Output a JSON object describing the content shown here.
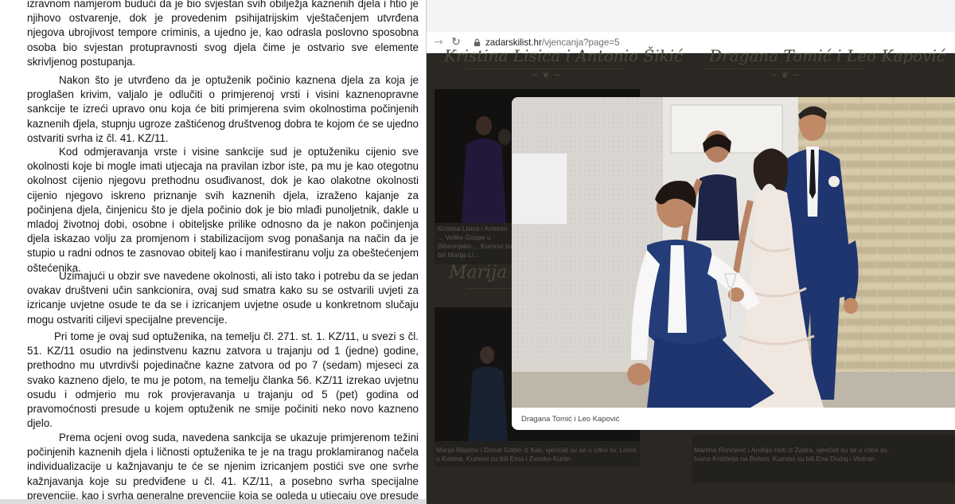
{
  "document": {
    "paragraphs": [
      "izravnom namjerom budući da je bio svjestan svih obilježja kaznenih djela i htio je njihovo ostvarenje, dok je provedenim psihijatrijskim vještačenjem utvrđena njegova ubrojivost tempore criminis, a ujedno je, kao odrasla poslovno sposobna osoba bio svjestan protupravnosti svog djela čime je ostvario sve elemente skrivljenog postupanja.",
      "Nakon što je utvrđeno da je optuženik počinio kaznena djela za koja je proglašen krivim, valjalo je odlučiti o primjerenoj vrsti i visini kaznenopravne sankcije te izreći upravo onu koja će biti primjerena svim okolnostima počinjenih kaznenih djela, stupnju ugroze zaštićenog društvenog dobra te kojom će se ujedno ostvariti svrha iz čl. 41. KZ/11.",
      "Kod odmjeravanja vrste i visine sankcije sud je optuženiku cijenio sve okolnosti koje bi mogle imati utjecaja na pravilan izbor iste, pa mu je kao otegotnu okolnost cijenio njegovu prethodnu osuđivanost, dok je kao olakotne okolnosti cijenio njegovo iskreno priznanje svih kaznenih djela, izraženo kajanje za počinjena djela, činjenicu što je djela počinio dok je bio mlađi punoljetnik, dakle u mladoj životnoj dobi, osobne i obiteljske prilike odnosno da je nakon počinjenja djela iskazao volju za promjenom i stabilizacijom svog ponašanja na način da je stupio u radni odnos te zasnovao obitelj kao i manifestiranu volju za obeštećenjem oštećenika.",
      "Uzimajući u obzir sve navedene okolnosti, ali isto tako i potrebu da se jedan ovakav društveni učin sankcionira, ovaj sud smatra kako su se ostvarili uvjeti za izricanje uvjetne osude te da se i izricanjem uvjetne osude u konkretnom slučaju mogu ostvariti ciljevi specijalne prevencije.",
      "Pri tome je ovaj sud optuženika, na temelju čl. 271. st. 1. KZ/11, u svezi s čl. 51. KZ/11 osudio  na jedinstvenu kaznu zatvora u trajanju od 1 (jedne) godine, prethodno mu utvrdivši pojedinačne kazne zatvora od po 7 (sedam) mjeseci za svako kazneno djelo, te mu je potom, na temelju članka 56. KZ/11 izrekao uvjetnu osudu i odmjerio mu rok provjeravanja u trajanju od 5 (pet) godina od pravomoćnosti presude u kojem optuženik ne smije počiniti neko novo kazneno djelo.",
      "Prema ocjeni ovog suda, navedena sankcija se ukazuje primjerenom težini počinjenih kaznenih djela i ličnosti optuženika te je na tragu proklamiranog načela individualizacije u kažnjavanju te će se njenim izricanjem postići sve one svrhe kažnjavanja koje su predviđene u čl. 41. KZ/11, a posebno svrha specijalne prevencije, kao i svrha generalne prevencije koja se ogleda u utjecaju ove presude na optuženika, ali i na sve druge da ne čine kaznena djela te kroz jačanje svijesti o"
    ]
  },
  "browser": {
    "url_domain": "zadarskilist.hr",
    "url_path": "/vjencanja?page=5",
    "background_page": {
      "heading_left": "Kristina Lisica i Antonio Šikić",
      "heading_right": "Dragana Tomić i Leo Kapović",
      "heading_middle": "Marija B",
      "caption_1": "Kristina Lisica i Antonio ... Velike Gospe u Biberinjaku ... Kumovi su bili Marija Li...",
      "caption_2": "Marija Blastov i Donat Gobin iz Kali, vjenčali su se u crkvi sv. Lovre u Kalima. Kumovi su bili Ema i Zvonko Kurtin",
      "caption_3": "Martina Rončević i Andrija Hoti iz Zadra, vjenčali su se u crkvi sv. Ivana Krstitelja na Belom. Kumovi su bili Ena Dodaj i Vedran"
    },
    "lightbox": {
      "caption": "Dragana Tomić i Leo Kapović"
    }
  },
  "colors": {
    "doc_text": "#141414",
    "page_bg": "#2b2823",
    "groom_suit": "#1f3570",
    "bridesmaid_dress": "#1d2448",
    "lightbox_bg": "#ffffff"
  }
}
